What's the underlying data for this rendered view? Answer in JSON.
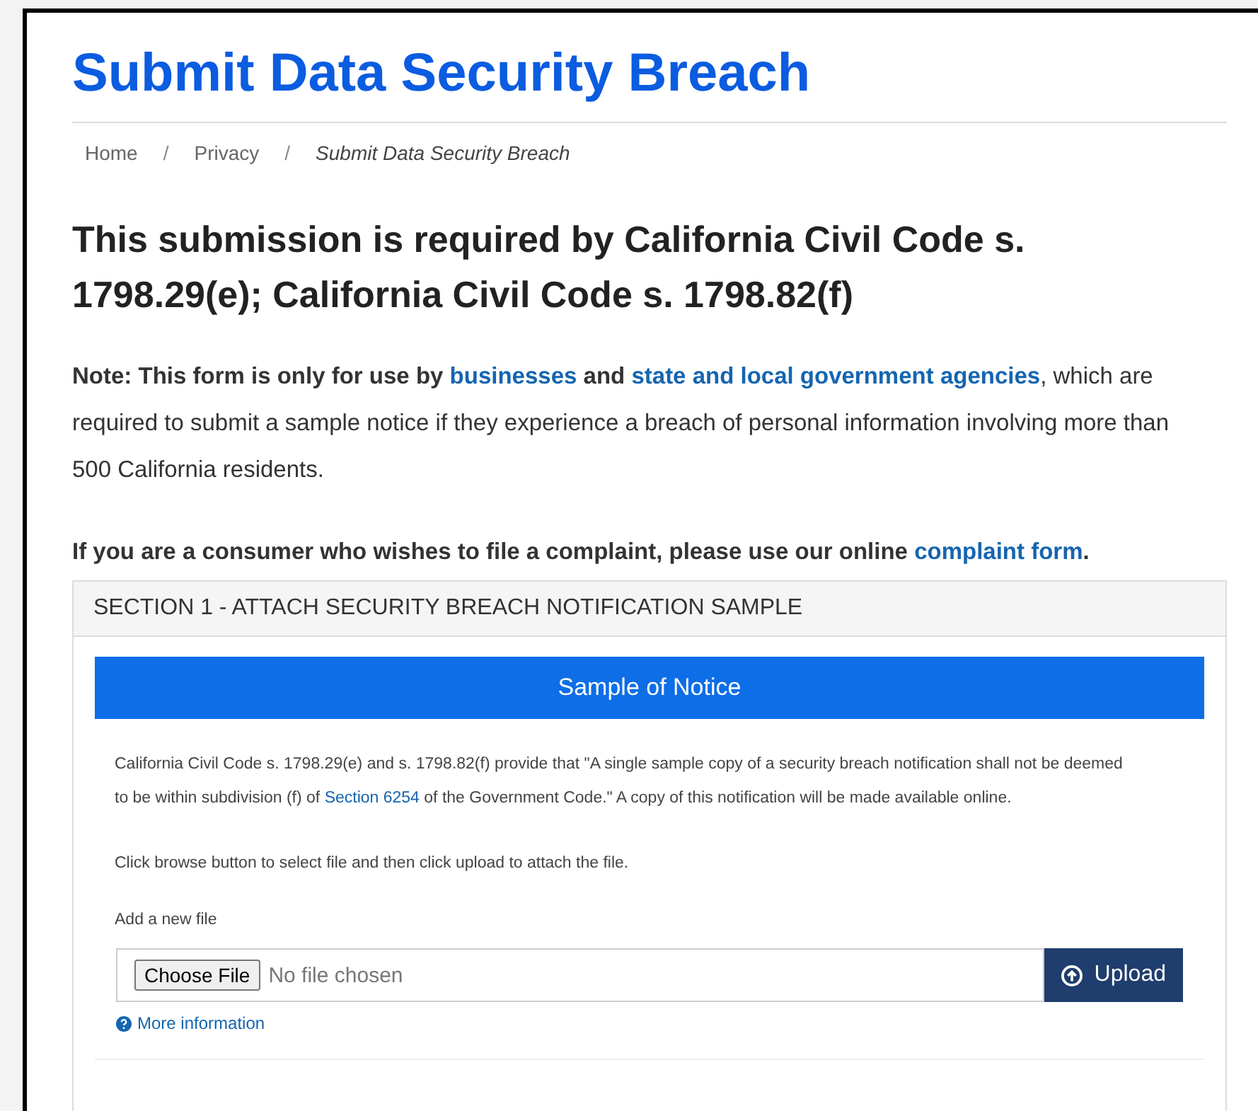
{
  "page_title": "Submit Data Security Breach",
  "breadcrumb_separator": "/",
  "breadcrumbs": [
    {
      "label": "Home",
      "current": false
    },
    {
      "label": "Privacy",
      "current": false
    },
    {
      "label": "Submit Data Security Breach",
      "current": true
    }
  ],
  "heading": "This submission is required by California Civil Code s. 1798.29(e); California Civil Code s. 1798.82(f)",
  "note": [
    {
      "kind": "bold",
      "text": "Note: This form is only for use by"
    },
    {
      "kind": "link",
      "text": "businesses"
    },
    {
      "kind": "bold",
      "text": "and"
    },
    {
      "kind": "link",
      "text": "state and local government agencies"
    },
    {
      "kind": "plain",
      "text": ", which are required to submit a sample notice if they experience a breach of personal information involving more than 500 California residents."
    }
  ],
  "consumer": [
    {
      "kind": "bold",
      "text": "If you are a consumer who wishes to file a complaint, please use our online"
    },
    {
      "kind": "link",
      "text": "complaint form"
    },
    {
      "kind": "bold",
      "text": "."
    }
  ],
  "section": {
    "title": "SECTION 1 - ATTACH SECURITY BREACH NOTIFICATION SAMPLE",
    "banner": "Sample of Notice",
    "legal": [
      {
        "kind": "plain",
        "text": "California Civil Code s. 1798.29(e) and s. 1798.82(f) provide that \"A single sample copy of a security breach notification shall not be deemed to be within subdivision (f) of"
      },
      {
        "kind": "link",
        "text": "Section 6254"
      },
      {
        "kind": "plain",
        "text": "of the Government Code.\" A copy of this notification will be made available online."
      }
    ],
    "instructions": "Click browse button to select file and then click upload to attach the file.",
    "file_label": "Add a new file",
    "choose_button": "Choose File",
    "file_status": "No file chosen",
    "upload_button": "Upload",
    "more_info": "More information"
  }
}
